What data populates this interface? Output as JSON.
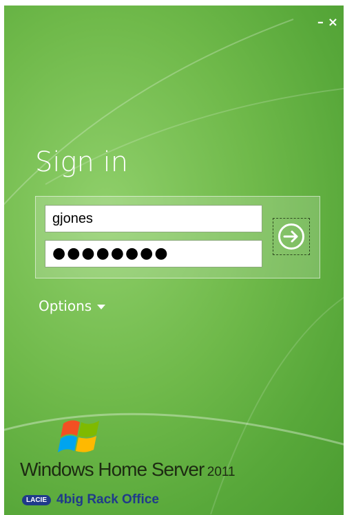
{
  "window": {
    "minimize_label": "–",
    "close_label": "×"
  },
  "signin": {
    "title": "Sign in",
    "username_value": "gjones",
    "password_value": "●●●●●●●●",
    "options_label": "Options"
  },
  "branding": {
    "product_name": "Windows Home Server",
    "product_year": "2011",
    "vendor_badge": "LACIE",
    "device_name": "4big Rack Office"
  },
  "colors": {
    "accent_green": "#6fb94a",
    "vendor_blue": "#1f3a8a"
  },
  "icons": {
    "submit": "arrow-right-circle-icon",
    "options": "caret-down-icon",
    "logo": "windows-flag-logo"
  }
}
